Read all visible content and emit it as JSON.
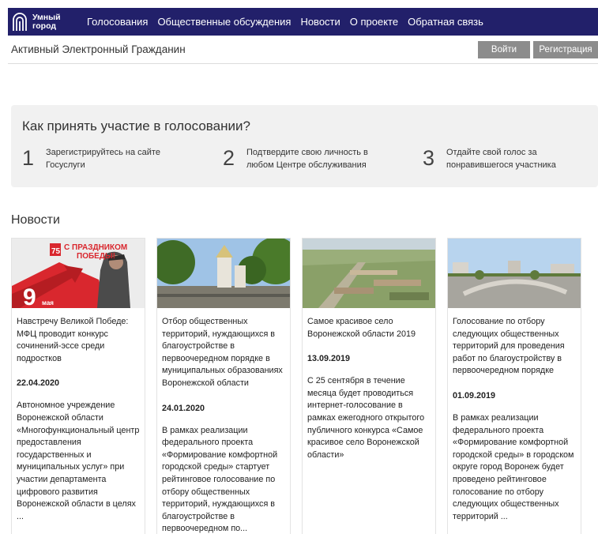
{
  "header": {
    "logo_line1": "Умный",
    "logo_line2": "город",
    "nav": [
      "Голосования",
      "Общественные обсуждения",
      "Новости",
      "О проекте",
      "Обратная связь"
    ]
  },
  "userbar": {
    "title": "Активный Электронный Гражданин",
    "login": "Войти",
    "register": "Регистрация"
  },
  "how": {
    "title": "Как принять участие в голосовании?",
    "steps": [
      {
        "num": "1",
        "text": "Зарегистрируйтесь на сайте Госуслуги"
      },
      {
        "num": "2",
        "text": "Подтвердите свою личность в любом Центре обслуживания"
      },
      {
        "num": "3",
        "text": "Отдайте свой голос за понравившегося участника"
      }
    ]
  },
  "news": {
    "title": "Новости",
    "items": [
      {
        "image": "victory-day-poster",
        "banner_line1": "С ПРАЗДНИКОМ",
        "banner_line2": "ПОБЕДЫ!",
        "banner_day": "9",
        "banner_month": "мая",
        "title": "Навстречу Великой Победе: МФЦ проводит конкурс сочинений-эссе среди подростков",
        "date": "22.04.2020",
        "text": "Автономное учреждение Воронежской области «Многофункциональный центр предоставления государственных и муниципальных услуг» при участии департамента цифрового развития Воронежской области в целях ..."
      },
      {
        "image": "city-park-photo",
        "title": "Отбор общественных территорий, нуждающихся в благоустройстве в первоочередном порядке в муниципальных образованиях Воронежской области",
        "date": "24.01.2020",
        "text": "В рамках реализации федерального проекта «Формирование комфортной городской среды» стартует рейтинговое голосование по отбору общественных территорий, нуждающихся в благоустройстве в первоочередном по..."
      },
      {
        "image": "village-aerial-photo",
        "title": "Самое красивое село Воронежской области 2019",
        "date": "13.09.2019",
        "text": "С 25 сентября в течение месяца будет проводиться интернет-голосование в рамках ежегодного открытого публичного конкурса «Самое красивое село Воронежской области»"
      },
      {
        "image": "city-square-photo",
        "title": "Голосование по отбору следующих общественных территорий для проведения работ по благоустройству в первоочередном порядке",
        "date": "01.09.2019",
        "text": "В рамках реализации федерального проекта «Формирование комфортной городской среды» в городском округе город Воронеж будет проведено рейтинговое голосование по отбору следующих общественных территорий ..."
      }
    ]
  },
  "colors": {
    "header_bg": "#22206a",
    "button_bg": "#8c8c8c",
    "panel_bg": "#f1f1f1",
    "banner_red": "#d9272e"
  }
}
